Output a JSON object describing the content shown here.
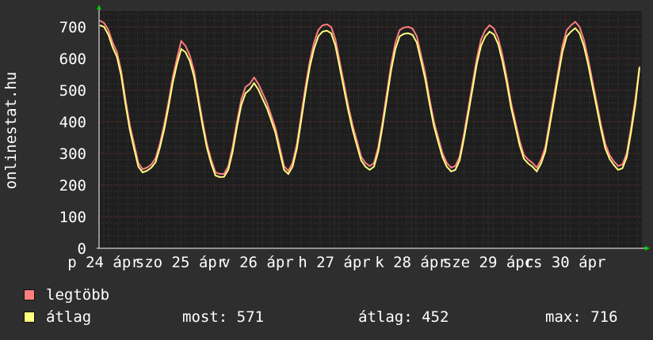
{
  "chart_data": {
    "type": "line",
    "ylabel": "onlinestat.hu",
    "ylim": [
      0,
      750
    ],
    "yticks": [
      0,
      100,
      200,
      300,
      400,
      500,
      600,
      700
    ],
    "grid": true,
    "x_tick_labels": [
      "p 24 ápr",
      "szo 25 ápr",
      "v 26 ápr",
      "h 27 ápr",
      "k 28 ápr",
      "sze 29 ápr",
      "cs 30 ápr"
    ],
    "series": [
      {
        "name": "legtöbb",
        "color": "#ff7f7f",
        "values": [
          720,
          712,
          690,
          650,
          620,
          560,
          470,
          390,
          330,
          270,
          250,
          255,
          265,
          285,
          330,
          390,
          460,
          540,
          600,
          655,
          640,
          610,
          560,
          480,
          400,
          330,
          280,
          240,
          235,
          235,
          260,
          320,
          400,
          470,
          510,
          520,
          540,
          520,
          490,
          460,
          420,
          380,
          320,
          260,
          245,
          270,
          330,
          420,
          510,
          590,
          650,
          690,
          705,
          708,
          700,
          660,
          590,
          520,
          450,
          390,
          340,
          290,
          270,
          260,
          270,
          320,
          400,
          490,
          580,
          650,
          690,
          698,
          700,
          695,
          670,
          610,
          550,
          470,
          400,
          350,
          300,
          270,
          255,
          260,
          290,
          360,
          440,
          520,
          600,
          660,
          690,
          705,
          695,
          665,
          610,
          540,
          460,
          400,
          340,
          295,
          280,
          270,
          255,
          280,
          320,
          400,
          480,
          560,
          640,
          690,
          705,
          716,
          700,
          660,
          600,
          530,
          460,
          390,
          330,
          295,
          275,
          260,
          265,
          300,
          380,
          470,
          575
        ]
      },
      {
        "name": "átlag",
        "color": "#ffff80",
        "values": [
          705,
          700,
          675,
          635,
          605,
          545,
          455,
          375,
          315,
          258,
          240,
          245,
          255,
          272,
          318,
          375,
          445,
          522,
          582,
          630,
          620,
          592,
          543,
          465,
          387,
          318,
          268,
          230,
          225,
          226,
          248,
          305,
          384,
          452,
          490,
          502,
          522,
          502,
          472,
          443,
          405,
          365,
          305,
          248,
          235,
          258,
          315,
          403,
          492,
          572,
          630,
          670,
          685,
          688,
          680,
          640,
          572,
          503,
          435,
          375,
          326,
          278,
          258,
          248,
          258,
          306,
          385,
          473,
          562,
          630,
          670,
          678,
          680,
          675,
          650,
          592,
          532,
          455,
          386,
          336,
          288,
          258,
          243,
          248,
          278,
          346,
          424,
          503,
          582,
          640,
          670,
          685,
          676,
          646,
          592,
          523,
          445,
          386,
          326,
          283,
          268,
          258,
          243,
          268,
          306,
          385,
          463,
          543,
          620,
          670,
          685,
          696,
          680,
          640,
          582,
          513,
          445,
          376,
          316,
          283,
          263,
          248,
          253,
          288,
          365,
          453,
          571
        ]
      }
    ]
  },
  "legend": [
    {
      "label": "legtöbb",
      "color": "#ff7f7f"
    },
    {
      "label": "átlag",
      "color": "#ffff80"
    }
  ],
  "stats": {
    "now": "most: 571",
    "avg": "átlag: 452",
    "max": "max: 716"
  },
  "colors": {
    "background": "#2e2e2e",
    "plot_background": "#1e1e1e",
    "grid_major": "#5a2a2a",
    "grid_minor": "#3e3e3e",
    "arrow": "#00cc00"
  }
}
